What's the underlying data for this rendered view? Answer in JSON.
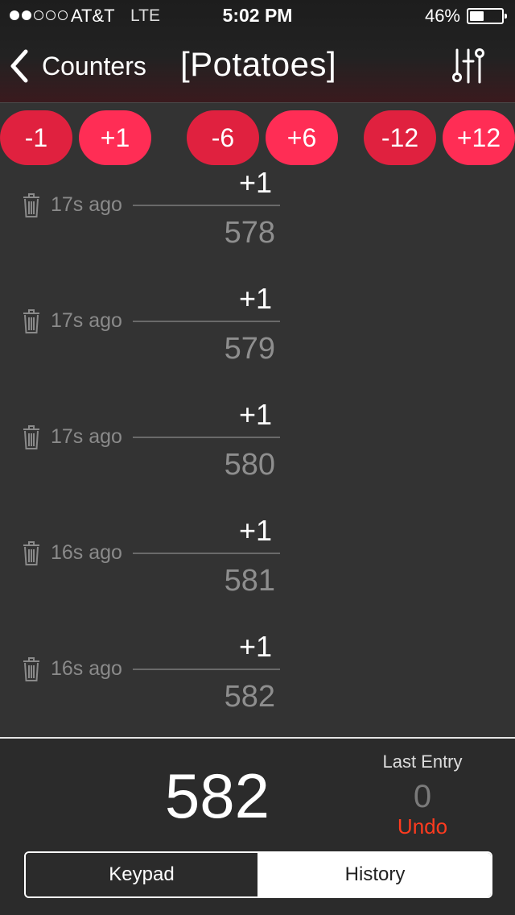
{
  "status_bar": {
    "signal_dots": [
      true,
      true,
      false,
      false,
      false
    ],
    "carrier": "AT&T",
    "network": "LTE",
    "time": "5:02 PM",
    "battery_percent": "46%",
    "battery_level": 0.46
  },
  "nav": {
    "back_label": "Counters",
    "title": "[Potatoes]",
    "settings_icon": "sliders-icon"
  },
  "increment_buttons": [
    {
      "label": "-1",
      "style": "dark"
    },
    {
      "label": "+1",
      "style": "bright"
    },
    {
      "label": "-6",
      "style": "dark"
    },
    {
      "label": "+6",
      "style": "bright"
    },
    {
      "label": "-12",
      "style": "dark"
    },
    {
      "label": "+12",
      "style": "bright"
    }
  ],
  "history": [
    {
      "delta": "+1",
      "time_ago": "17s ago",
      "total": "578"
    },
    {
      "delta": "+1",
      "time_ago": "17s ago",
      "total": "579"
    },
    {
      "delta": "+1",
      "time_ago": "17s ago",
      "total": "580"
    },
    {
      "delta": "+1",
      "time_ago": "16s ago",
      "total": "581"
    },
    {
      "delta": "+1",
      "time_ago": "16s ago",
      "total": "582"
    }
  ],
  "summary": {
    "count": "582",
    "last_entry_label": "Last Entry",
    "last_entry_value": "0",
    "undo_label": "Undo"
  },
  "tabs": {
    "keypad": "Keypad",
    "history": "History",
    "selected": "History"
  },
  "colors": {
    "accent": "#ff2d55",
    "accent_dark": "#e0213f",
    "undo": "#ff3b1f",
    "background": "#333333"
  }
}
